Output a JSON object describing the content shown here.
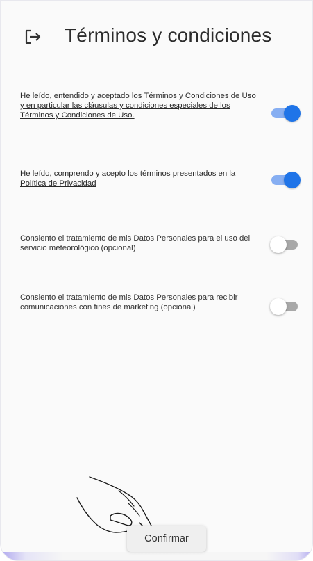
{
  "header": {
    "title": "Términos y condiciones",
    "back_icon": "logout-arrow-icon"
  },
  "consents": [
    {
      "text": "He leído, entendido y aceptado los Términos y Condiciones de Uso y en particular las cláusulas y condiciones especiales de los Términos y Condiciones de Uso.",
      "underlined": true,
      "checked": true
    },
    {
      "text": "He leído, comprendo y acepto los términos presentados en la Política de Privacidad",
      "underlined": true,
      "checked": true
    },
    {
      "text": "Consiento el tratamiento de mis Datos Personales para el uso del servicio meteorológico (opcional)",
      "underlined": false,
      "checked": false
    },
    {
      "text": "Consiento el tratamiento de mis Datos Personales para recibir comunicaciones con fines de marketing (opcional)",
      "underlined": false,
      "checked": false
    }
  ],
  "actions": {
    "confirm_label": "Confirmar"
  },
  "colors": {
    "switch_on_thumb": "#1f74e8",
    "switch_on_track": "#86aef2",
    "switch_off_track": "#a8a8a8"
  }
}
